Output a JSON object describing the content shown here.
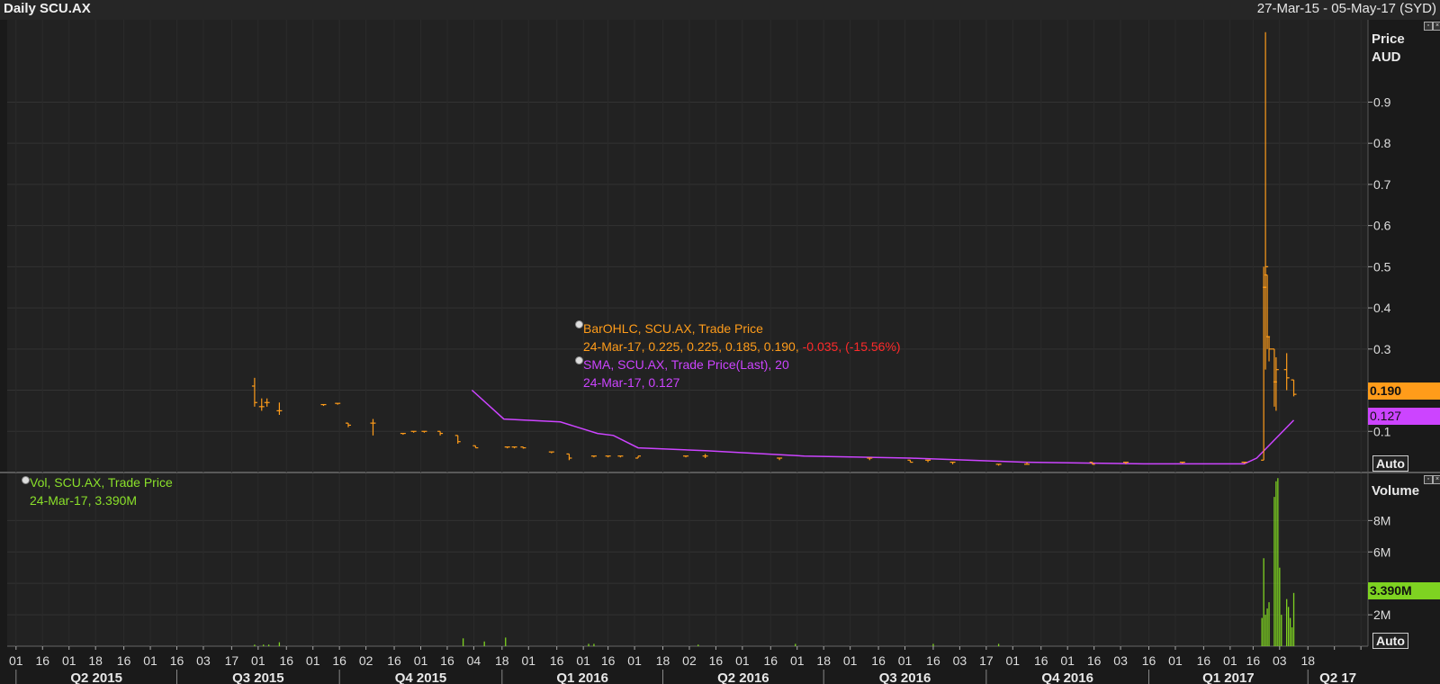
{
  "header": {
    "title": "Daily SCU.AX",
    "date_range": "27-Mar-15 - 05-May-17 (SYD)"
  },
  "legend_price": {
    "bar_label": "BarOHLC, SCU.AX, Trade Price",
    "bar_values": "24-Mar-17, 0.225, 0.225, 0.185, 0.190,",
    "bar_change": "-0.035, (-15.56%)",
    "sma_label": "SMA, SCU.AX, Trade Price(Last),  20",
    "sma_values": "24-Mar-17, 0.127"
  },
  "legend_volume": {
    "label": "Vol, SCU.AX, Trade Price",
    "values": "24-Mar-17, 3.390M"
  },
  "price_axis": {
    "title_line1": "Price",
    "title_line2": "AUD",
    "auto_label": "Auto"
  },
  "volume_axis": {
    "title": "Volume",
    "auto_label": "Auto"
  },
  "tags": {
    "last_price": "0.190",
    "sma": "0.127",
    "volume": "3.390M"
  },
  "colors": {
    "ohlc": "#ff9c1a",
    "sma": "#cc44ff",
    "volume": "#7ed321",
    "change": "#ff2a2a",
    "background": "#222222"
  },
  "chart_data": [
    {
      "type": "bar",
      "subtype": "ohlc",
      "ylabel": "Price AUD",
      "ylim": [
        0,
        1.1
      ],
      "yticks": [
        0.1,
        0.2,
        0.3,
        0.4,
        0.5,
        0.6,
        0.7,
        0.8,
        0.9
      ],
      "ytick_labels": [
        "0.1",
        "",
        "0.3",
        "0.4",
        "0.5",
        "0.6",
        "0.7",
        "0.8",
        "0.9"
      ],
      "grid": true,
      "series": [
        {
          "name": "BarOHLC, SCU.AX, Trade Price",
          "points": [
            {
              "d": "2015-08-14",
              "o": 0.21,
              "h": 0.23,
              "l": 0.16,
              "c": 0.17
            },
            {
              "d": "2015-08-18",
              "o": 0.16,
              "h": 0.18,
              "l": 0.15,
              "c": 0.16
            },
            {
              "d": "2015-08-21",
              "o": 0.17,
              "h": 0.18,
              "l": 0.16,
              "c": 0.17
            },
            {
              "d": "2015-08-28",
              "o": 0.15,
              "h": 0.17,
              "l": 0.14,
              "c": 0.15
            },
            {
              "d": "2015-09-22",
              "o": 0.165,
              "h": 0.165,
              "l": 0.165,
              "c": 0.165
            },
            {
              "d": "2015-09-30",
              "o": 0.168,
              "h": 0.168,
              "l": 0.168,
              "c": 0.168
            },
            {
              "d": "2015-10-06",
              "o": 0.12,
              "h": 0.12,
              "l": 0.11,
              "c": 0.115
            },
            {
              "d": "2015-10-20",
              "o": 0.12,
              "h": 0.13,
              "l": 0.09,
              "c": 0.12
            },
            {
              "d": "2015-11-06",
              "o": 0.095,
              "h": 0.095,
              "l": 0.095,
              "c": 0.095
            },
            {
              "d": "2015-11-12",
              "o": 0.1,
              "h": 0.1,
              "l": 0.1,
              "c": 0.1
            },
            {
              "d": "2015-11-18",
              "o": 0.1,
              "h": 0.1,
              "l": 0.1,
              "c": 0.1
            },
            {
              "d": "2015-11-27",
              "o": 0.1,
              "h": 0.1,
              "l": 0.09,
              "c": 0.095
            },
            {
              "d": "2015-12-07",
              "o": 0.09,
              "h": 0.09,
              "l": 0.07,
              "c": 0.075
            },
            {
              "d": "2015-12-17",
              "o": 0.065,
              "h": 0.065,
              "l": 0.06,
              "c": 0.06
            },
            {
              "d": "2016-01-04",
              "o": 0.062,
              "h": 0.062,
              "l": 0.062,
              "c": 0.062
            },
            {
              "d": "2016-01-08",
              "o": 0.062,
              "h": 0.062,
              "l": 0.062,
              "c": 0.062
            },
            {
              "d": "2016-01-13",
              "o": 0.062,
              "h": 0.062,
              "l": 0.058,
              "c": 0.06
            },
            {
              "d": "2016-01-29",
              "o": 0.05,
              "h": 0.05,
              "l": 0.05,
              "c": 0.05
            },
            {
              "d": "2016-02-08",
              "o": 0.045,
              "h": 0.045,
              "l": 0.03,
              "c": 0.035
            },
            {
              "d": "2016-02-22",
              "o": 0.04,
              "h": 0.04,
              "l": 0.04,
              "c": 0.04
            },
            {
              "d": "2016-03-01",
              "o": 0.04,
              "h": 0.04,
              "l": 0.04,
              "c": 0.04
            },
            {
              "d": "2016-03-08",
              "o": 0.04,
              "h": 0.04,
              "l": 0.04,
              "c": 0.04
            },
            {
              "d": "2016-03-18",
              "o": 0.035,
              "h": 0.04,
              "l": 0.035,
              "c": 0.04
            },
            {
              "d": "2016-04-14",
              "o": 0.04,
              "h": 0.04,
              "l": 0.04,
              "c": 0.04
            },
            {
              "d": "2016-04-25",
              "o": 0.04,
              "h": 0.045,
              "l": 0.035,
              "c": 0.04
            },
            {
              "d": "2016-06-06",
              "o": 0.035,
              "h": 0.035,
              "l": 0.03,
              "c": 0.035
            },
            {
              "d": "2016-07-27",
              "o": 0.035,
              "h": 0.035,
              "l": 0.03,
              "c": 0.035
            },
            {
              "d": "2016-08-19",
              "o": 0.03,
              "h": 0.03,
              "l": 0.025,
              "c": 0.025
            },
            {
              "d": "2016-08-29",
              "o": 0.03,
              "h": 0.03,
              "l": 0.025,
              "c": 0.03
            },
            {
              "d": "2016-09-12",
              "o": 0.025,
              "h": 0.025,
              "l": 0.02,
              "c": 0.025
            },
            {
              "d": "2016-10-08",
              "o": 0.02,
              "h": 0.02,
              "l": 0.02,
              "c": 0.02
            },
            {
              "d": "2016-10-24",
              "o": 0.02,
              "h": 0.025,
              "l": 0.02,
              "c": 0.02
            },
            {
              "d": "2016-11-30",
              "o": 0.025,
              "h": 0.025,
              "l": 0.02,
              "c": 0.02
            },
            {
              "d": "2016-12-19",
              "o": 0.025,
              "h": 0.025,
              "l": 0.02,
              "c": 0.025
            },
            {
              "d": "2017-01-20",
              "o": 0.025,
              "h": 0.025,
              "l": 0.025,
              "c": 0.025
            },
            {
              "d": "2017-02-24",
              "o": 0.025,
              "h": 0.025,
              "l": 0.025,
              "c": 0.025
            },
            {
              "d": "2017-03-07",
              "o": 0.03,
              "h": 0.5,
              "l": 0.03,
              "c": 0.45
            },
            {
              "d": "2017-03-08",
              "o": 0.45,
              "h": 1.07,
              "l": 0.25,
              "c": 0.5
            },
            {
              "d": "2017-03-09",
              "o": 0.48,
              "h": 0.48,
              "l": 0.3,
              "c": 0.33
            },
            {
              "d": "2017-03-10",
              "o": 0.33,
              "h": 0.33,
              "l": 0.27,
              "c": 0.3
            },
            {
              "d": "2017-03-13",
              "o": 0.3,
              "h": 0.3,
              "l": 0.16,
              "c": 0.22
            },
            {
              "d": "2017-03-14",
              "o": 0.22,
              "h": 0.28,
              "l": 0.15,
              "c": 0.25
            },
            {
              "d": "2017-03-20",
              "o": 0.25,
              "h": 0.29,
              "l": 0.2,
              "c": 0.23
            },
            {
              "d": "2017-03-24",
              "o": 0.225,
              "h": 0.225,
              "l": 0.185,
              "c": 0.19
            }
          ]
        },
        {
          "name": "SMA, SCU.AX, Trade Price(Last),  20",
          "x": [
            "2015-12-15",
            "2016-01-02",
            "2016-02-03",
            "2016-02-24",
            "2016-03-04",
            "2016-03-18",
            "2016-04-25",
            "2016-06-20",
            "2016-08-19",
            "2016-10-24",
            "2016-12-29",
            "2017-02-24",
            "2017-03-03",
            "2017-03-24"
          ],
          "y": [
            0.2,
            0.13,
            0.123,
            0.095,
            0.09,
            0.06,
            0.053,
            0.04,
            0.035,
            0.025,
            0.021,
            0.021,
            0.035,
            0.127
          ]
        }
      ]
    },
    {
      "type": "bar",
      "ylabel": "Volume",
      "ylim": [
        0,
        11000000
      ],
      "yticks": [
        2000000,
        4000000,
        6000000,
        8000000
      ],
      "ytick_labels": [
        "2M",
        "",
        "6M",
        "8M"
      ],
      "grid": true,
      "series": [
        {
          "name": "Vol, SCU.AX, Trade Price",
          "x": [
            "2015-08-14",
            "2015-08-19",
            "2015-08-22",
            "2015-08-28",
            "2015-12-10",
            "2015-12-22",
            "2016-01-03",
            "2016-02-19",
            "2016-02-22",
            "2016-04-21",
            "2016-06-15",
            "2016-09-01",
            "2016-10-08",
            "2017-03-06",
            "2017-03-07",
            "2017-03-08",
            "2017-03-09",
            "2017-03-10",
            "2017-03-13",
            "2017-03-14",
            "2017-03-15",
            "2017-03-16",
            "2017-03-17",
            "2017-03-20",
            "2017-03-21",
            "2017-03-22",
            "2017-03-23",
            "2017-03-24"
          ],
          "y": [
            100000,
            100000,
            100000,
            250000,
            500000,
            300000,
            550000,
            150000,
            150000,
            100000,
            150000,
            150000,
            150000,
            1800000,
            5600000,
            2000000,
            2400000,
            2800000,
            9500000,
            10500000,
            10700000,
            5000000,
            2000000,
            3000000,
            2500000,
            1800000,
            1200000,
            3390000
          ]
        }
      ]
    }
  ],
  "x_axis": {
    "day_labels": [
      "01",
      "16",
      "01",
      "18",
      "16",
      "01",
      "16",
      "03",
      "17",
      "01",
      "16",
      "01",
      "16",
      "02",
      "16",
      "01",
      "16",
      "04",
      "18",
      "01",
      "16",
      "01",
      "16",
      "01",
      "18",
      "02",
      "16",
      "01",
      "16",
      "01",
      "18",
      "01",
      "16",
      "01",
      "16",
      "03",
      "17",
      "01",
      "16",
      "01",
      "16",
      "03",
      "16",
      "01",
      "16",
      "01",
      "16",
      "03",
      "18"
    ],
    "quarter_labels": [
      "Q2 2015",
      "Q3 2015",
      "Q4 2015",
      "Q1 2016",
      "Q2 2016",
      "Q3 2016",
      "Q4 2016",
      "Q1 2017",
      "Q2 17"
    ]
  }
}
